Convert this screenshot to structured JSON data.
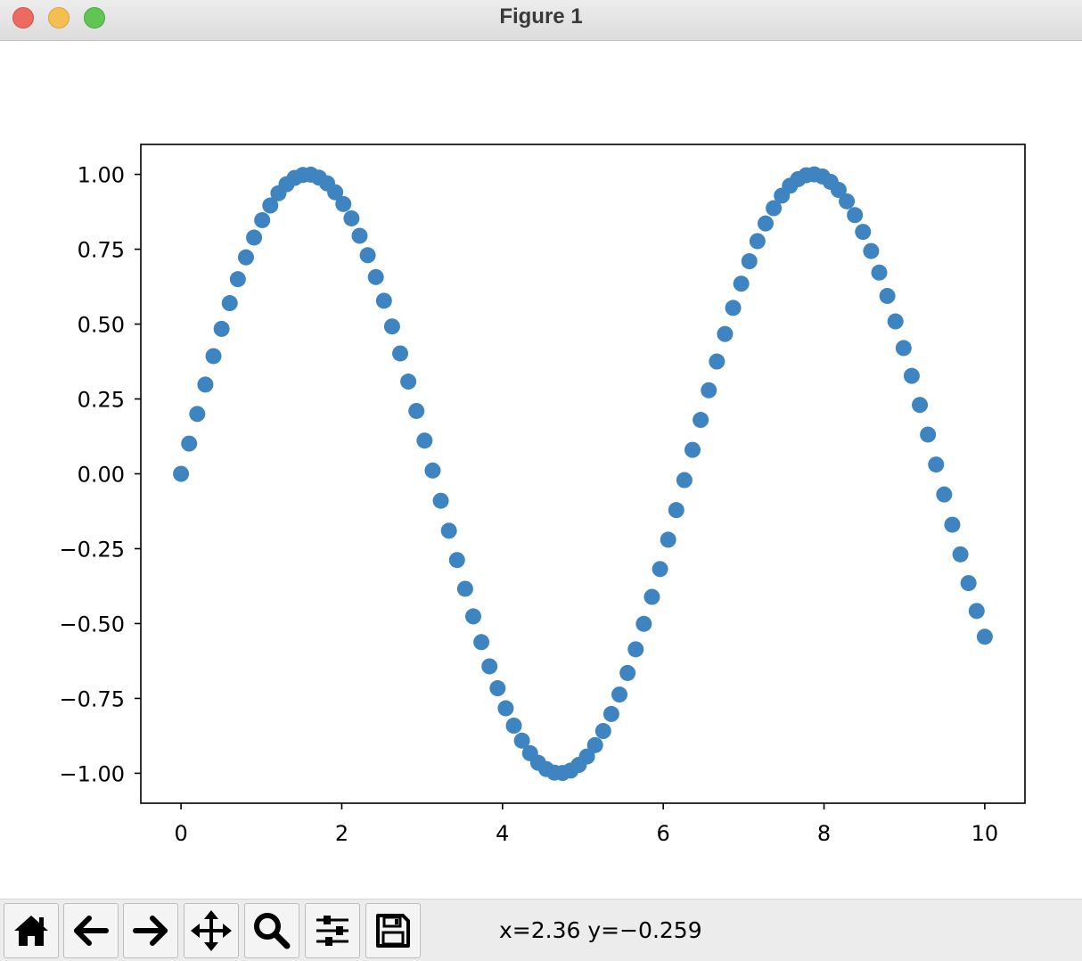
{
  "window": {
    "title": "Figure 1",
    "traffic_lights": [
      {
        "name": "close",
        "color": "#ed6a5e",
        "border": "#d3534a"
      },
      {
        "name": "minimize",
        "color": "#f5bf4f",
        "border": "#d9a33b"
      },
      {
        "name": "zoom",
        "color": "#61c554",
        "border": "#4ea841"
      }
    ]
  },
  "toolbar": {
    "buttons": [
      {
        "icon": "home-icon",
        "action": "home"
      },
      {
        "icon": "arrow-left-icon",
        "action": "back"
      },
      {
        "icon": "arrow-right-icon",
        "action": "forward"
      },
      {
        "icon": "move-icon",
        "action": "pan"
      },
      {
        "icon": "magnifier-icon",
        "action": "zoom"
      },
      {
        "icon": "sliders-icon",
        "action": "configure-subplots"
      },
      {
        "icon": "floppy-disk-icon",
        "action": "save"
      }
    ],
    "coordinates": "x=2.36 y=−0.259"
  },
  "chart_data": {
    "type": "scatter",
    "title": "",
    "xlabel": "",
    "ylabel": "",
    "marker_color": "#3d84c0",
    "grid": false,
    "legend": "none",
    "xlim": [
      -0.5,
      10.5
    ],
    "ylim": [
      -1.1,
      1.1
    ],
    "xticks": [
      0,
      2,
      4,
      6,
      8,
      10
    ],
    "xtick_labels": [
      "0",
      "2",
      "4",
      "6",
      "8",
      "10"
    ],
    "yticks": [
      1.0,
      0.75,
      0.5,
      0.25,
      0.0,
      -0.25,
      -0.5,
      -0.75,
      -1.0
    ],
    "ytick_labels": [
      "1.00",
      "0.75",
      "0.50",
      "0.25",
      "0.00",
      "−0.25",
      "−0.50",
      "−0.75",
      "−1.00"
    ],
    "series": [
      {
        "x": [
          0.0,
          0.101,
          0.202,
          0.303,
          0.404,
          0.505,
          0.606,
          0.707,
          0.808,
          0.909,
          1.01,
          1.111,
          1.212,
          1.313,
          1.414,
          1.515,
          1.616,
          1.717,
          1.818,
          1.919,
          2.02,
          2.121,
          2.222,
          2.323,
          2.424,
          2.525,
          2.626,
          2.727,
          2.828,
          2.929,
          3.03,
          3.131,
          3.232,
          3.333,
          3.434,
          3.535,
          3.636,
          3.737,
          3.838,
          3.939,
          4.04,
          4.141,
          4.242,
          4.343,
          4.444,
          4.545,
          4.646,
          4.747,
          4.848,
          4.949,
          5.051,
          5.152,
          5.253,
          5.354,
          5.455,
          5.556,
          5.657,
          5.758,
          5.859,
          5.96,
          6.061,
          6.162,
          6.263,
          6.364,
          6.465,
          6.566,
          6.667,
          6.768,
          6.869,
          6.97,
          7.071,
          7.172,
          7.273,
          7.374,
          7.475,
          7.576,
          7.677,
          7.778,
          7.879,
          7.98,
          8.081,
          8.182,
          8.283,
          8.384,
          8.485,
          8.586,
          8.687,
          8.788,
          8.889,
          8.99,
          9.091,
          9.192,
          9.293,
          9.394,
          9.495,
          9.596,
          9.697,
          9.798,
          9.899,
          10.0
        ],
        "y": [
          0.0,
          0.101,
          0.2,
          0.298,
          0.393,
          0.484,
          0.57,
          0.65,
          0.723,
          0.789,
          0.847,
          0.896,
          0.937,
          0.967,
          0.988,
          0.998,
          0.999,
          0.989,
          0.97,
          0.94,
          0.901,
          0.853,
          0.795,
          0.73,
          0.657,
          0.578,
          0.492,
          0.402,
          0.308,
          0.21,
          0.111,
          0.011,
          -0.09,
          -0.19,
          -0.288,
          -0.384,
          -0.476,
          -0.562,
          -0.643,
          -0.716,
          -0.783,
          -0.841,
          -0.891,
          -0.933,
          -0.965,
          -0.986,
          -0.998,
          -0.999,
          -0.991,
          -0.972,
          -0.944,
          -0.906,
          -0.859,
          -0.802,
          -0.737,
          -0.665,
          -0.586,
          -0.501,
          -0.411,
          -0.318,
          -0.22,
          -0.121,
          -0.021,
          0.08,
          0.18,
          0.279,
          0.375,
          0.467,
          0.554,
          0.635,
          0.71,
          0.777,
          0.836,
          0.887,
          0.929,
          0.962,
          0.984,
          0.997,
          1.0,
          0.993,
          0.975,
          0.948,
          0.91,
          0.864,
          0.808,
          0.744,
          0.672,
          0.594,
          0.509,
          0.42,
          0.327,
          0.23,
          0.131,
          0.031,
          -0.069,
          -0.17,
          -0.269,
          -0.365,
          -0.458,
          -0.544
        ]
      }
    ]
  }
}
